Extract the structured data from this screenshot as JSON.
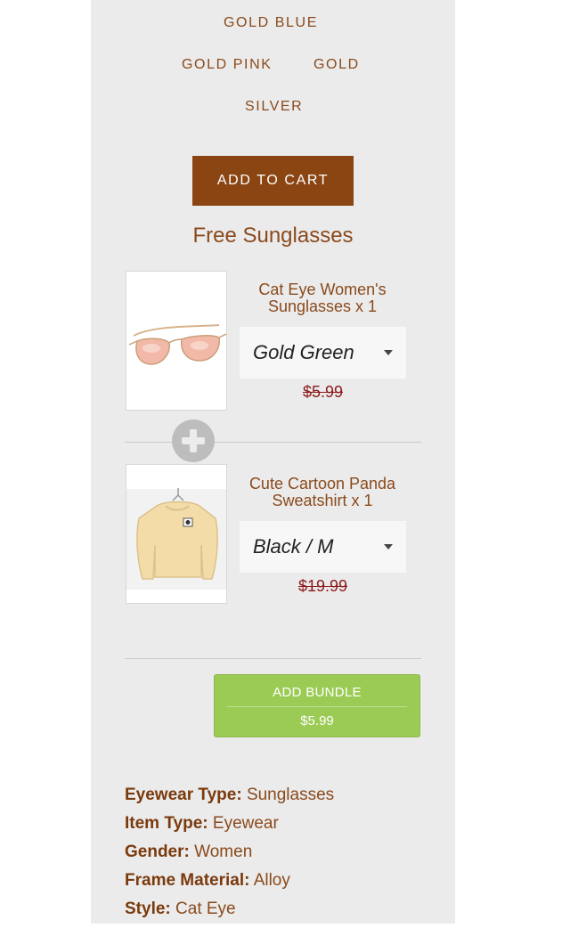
{
  "variants": [
    "GOLD BLUE",
    "GOLD PINK",
    "GOLD",
    "SILVER"
  ],
  "add_to_cart_label": "ADD TO CART",
  "bundle_section": {
    "title": "Free Sunglasses",
    "items": [
      {
        "title": "Cat Eye Women's Sunglasses x 1",
        "selected_option": "Gold Green",
        "price": "$5.99"
      },
      {
        "title": "Cute Cartoon Panda Sweatshirt x 1",
        "selected_option": "Black / M",
        "price": "$19.99"
      }
    ],
    "add_bundle_label": "ADD BUNDLE",
    "bundle_price": "$5.99"
  },
  "specs": [
    {
      "label": "Eyewear Type:",
      "value": "Sunglasses"
    },
    {
      "label": "Item Type:",
      "value": "Eyewear"
    },
    {
      "label": "Gender:",
      "value": "Women"
    },
    {
      "label": "Frame Material:",
      "value": "Alloy"
    },
    {
      "label": "Style:",
      "value": "Cat Eye"
    }
  ],
  "colors": {
    "brand_brown": "#8a4513",
    "text_brown": "#8a4a1c",
    "bundle_green": "#9ccb55",
    "strike_red": "#8b1a1a"
  },
  "icons": [
    "plus-icon",
    "chevron-down-icon"
  ]
}
